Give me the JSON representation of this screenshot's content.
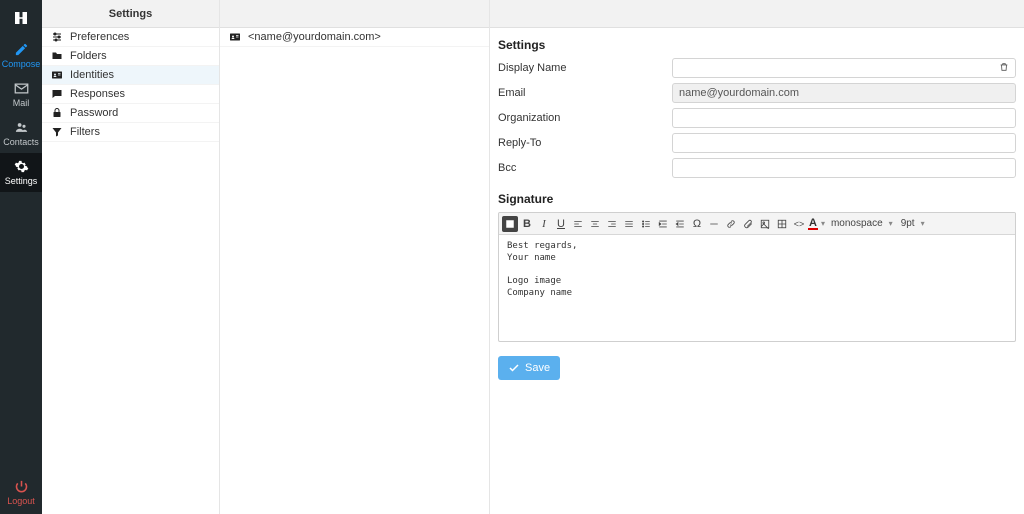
{
  "rail": {
    "compose": "Compose",
    "mail": "Mail",
    "contacts": "Contacts",
    "settings": "Settings",
    "logout": "Logout"
  },
  "col1": {
    "title": "Settings",
    "items": [
      {
        "icon": "sliders",
        "label": "Preferences"
      },
      {
        "icon": "folder",
        "label": "Folders"
      },
      {
        "icon": "id-card",
        "label": "Identities"
      },
      {
        "icon": "chat",
        "label": "Responses"
      },
      {
        "icon": "lock",
        "label": "Password"
      },
      {
        "icon": "filter",
        "label": "Filters"
      }
    ]
  },
  "col2": {
    "items": [
      {
        "label": "<name@yourdomain.com>"
      }
    ]
  },
  "form": {
    "settings_title": "Settings",
    "fields": {
      "display_name": {
        "label": "Display Name",
        "value": ""
      },
      "email": {
        "label": "Email",
        "value": "name@yourdomain.com"
      },
      "organization": {
        "label": "Organization",
        "value": ""
      },
      "reply_to": {
        "label": "Reply-To",
        "value": ""
      },
      "bcc": {
        "label": "Bcc",
        "value": ""
      }
    },
    "signature_title": "Signature",
    "toolbar": {
      "font_family": "monospace",
      "font_size": "9pt"
    },
    "signature_body": "Best regards,\nYour name\n\nLogo image\nCompany name",
    "save": "Save"
  }
}
